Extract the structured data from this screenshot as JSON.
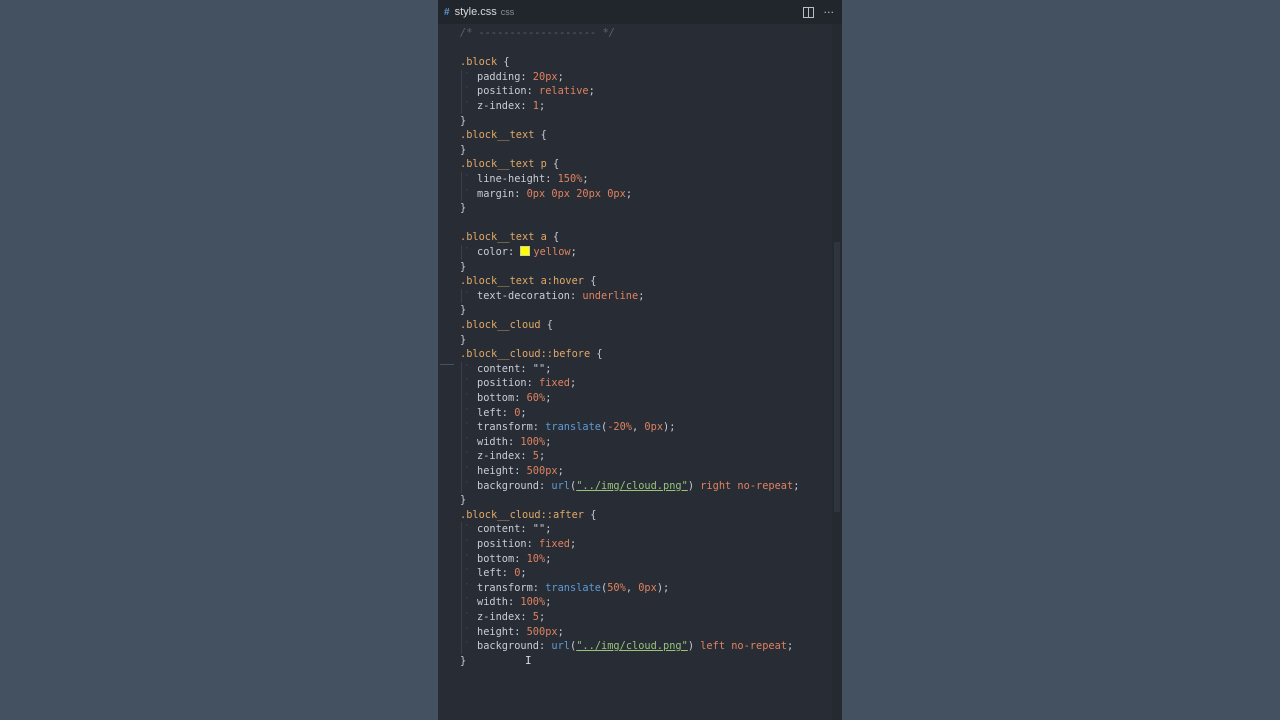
{
  "tab": {
    "icon": "#",
    "filename": "style.css",
    "language": "css"
  },
  "actions": {
    "split_icon": "split-editor-icon",
    "more_label": "···"
  },
  "code_lines": [
    {
      "text": "/* ------------------- */",
      "kind": "comment"
    },
    {
      "text": "",
      "kind": "blank"
    },
    {
      "text": ".block {",
      "kind": "sel"
    },
    {
      "text": "padding: 20px;",
      "kind": "decl",
      "prop": "padding",
      "val": "20px",
      "vtype": "num"
    },
    {
      "text": "position: relative;",
      "kind": "decl",
      "prop": "position",
      "val": "relative",
      "vtype": "val"
    },
    {
      "text": "z-index: 1;",
      "kind": "decl",
      "prop": "z-index",
      "val": "1",
      "vtype": "num"
    },
    {
      "text": "}",
      "kind": "close"
    },
    {
      "text": ".block__text {",
      "kind": "sel"
    },
    {
      "text": "}",
      "kind": "close"
    },
    {
      "text": ".block__text p {",
      "kind": "sel"
    },
    {
      "text": "line-height: 150%;",
      "kind": "decl",
      "prop": "line-height",
      "val": "150%",
      "vtype": "num"
    },
    {
      "text": "margin: 0px 0px 20px 0px;",
      "kind": "decl",
      "prop": "margin",
      "val": "0px 0px 20px 0px",
      "vtype": "num"
    },
    {
      "text": "}",
      "kind": "close"
    },
    {
      "text": "",
      "kind": "blank"
    },
    {
      "text": ".block__text a {",
      "kind": "sel"
    },
    {
      "text": "color: yellow;",
      "kind": "decl",
      "prop": "color",
      "val": "yellow",
      "vtype": "color",
      "swatch": "#ffff00"
    },
    {
      "text": "}",
      "kind": "close"
    },
    {
      "text": ".block__text a:hover {",
      "kind": "sel"
    },
    {
      "text": "text-decoration: underline;",
      "kind": "decl",
      "prop": "text-decoration",
      "val": "underline",
      "vtype": "val"
    },
    {
      "text": "}",
      "kind": "close"
    },
    {
      "text": ".block__cloud {",
      "kind": "sel"
    },
    {
      "text": "}",
      "kind": "close"
    },
    {
      "text": ".block__cloud::before {",
      "kind": "sel"
    },
    {
      "text": "content: \"\";",
      "kind": "decl",
      "prop": "content",
      "val": "\"\"",
      "vtype": "plain"
    },
    {
      "text": "position: fixed;",
      "kind": "decl",
      "prop": "position",
      "val": "fixed",
      "vtype": "val"
    },
    {
      "text": "bottom: 60%;",
      "kind": "decl",
      "prop": "bottom",
      "val": "60%",
      "vtype": "num"
    },
    {
      "text": "left: 0;",
      "kind": "decl",
      "prop": "left",
      "val": "0",
      "vtype": "num"
    },
    {
      "text": "transform: translate(-20%, 0px);",
      "kind": "decl",
      "prop": "transform",
      "fn": "translate",
      "args": "-20%, 0px",
      "vtype": "fn"
    },
    {
      "text": "width: 100%;",
      "kind": "decl",
      "prop": "width",
      "val": "100%",
      "vtype": "num"
    },
    {
      "text": "z-index: 5;",
      "kind": "decl",
      "prop": "z-index",
      "val": "5",
      "vtype": "num"
    },
    {
      "text": "height: 500px;",
      "kind": "decl",
      "prop": "height",
      "val": "500px",
      "vtype": "num"
    },
    {
      "text": "background: url(\"../img/cloud.png\") right no-repeat;",
      "kind": "decl",
      "prop": "background",
      "fn": "url",
      "str": "\"../img/cloud.png\"",
      "tail": "right no-repeat",
      "vtype": "url"
    },
    {
      "text": "}",
      "kind": "close"
    },
    {
      "text": ".block__cloud::after {",
      "kind": "sel"
    },
    {
      "text": "content: \"\";",
      "kind": "decl",
      "prop": "content",
      "val": "\"\"",
      "vtype": "plain"
    },
    {
      "text": "position: fixed;",
      "kind": "decl",
      "prop": "position",
      "val": "fixed",
      "vtype": "val"
    },
    {
      "text": "bottom: 10%;",
      "kind": "decl",
      "prop": "bottom",
      "val": "10%",
      "vtype": "num"
    },
    {
      "text": "left: 0;",
      "kind": "decl",
      "prop": "left",
      "val": "0",
      "vtype": "num"
    },
    {
      "text": "transform: translate(50%, 0px);",
      "kind": "decl",
      "prop": "transform",
      "fn": "translate",
      "args": "50%, 0px",
      "vtype": "fn"
    },
    {
      "text": "width: 100%;",
      "kind": "decl",
      "prop": "width",
      "val": "100%",
      "vtype": "num"
    },
    {
      "text": "z-index: 5;",
      "kind": "decl",
      "prop": "z-index",
      "val": "5",
      "vtype": "num"
    },
    {
      "text": "height: 500px;",
      "kind": "decl",
      "prop": "height",
      "val": "500px",
      "vtype": "num"
    },
    {
      "text": "background: url(\"../img/cloud.png\") left no-repeat;",
      "kind": "decl",
      "prop": "background",
      "fn": "url",
      "str": "\"../img/cloud.png\"",
      "tail": "left no-repeat",
      "vtype": "url"
    },
    {
      "text": "}",
      "kind": "close"
    }
  ],
  "cursor_icon": "text-cursor-icon"
}
